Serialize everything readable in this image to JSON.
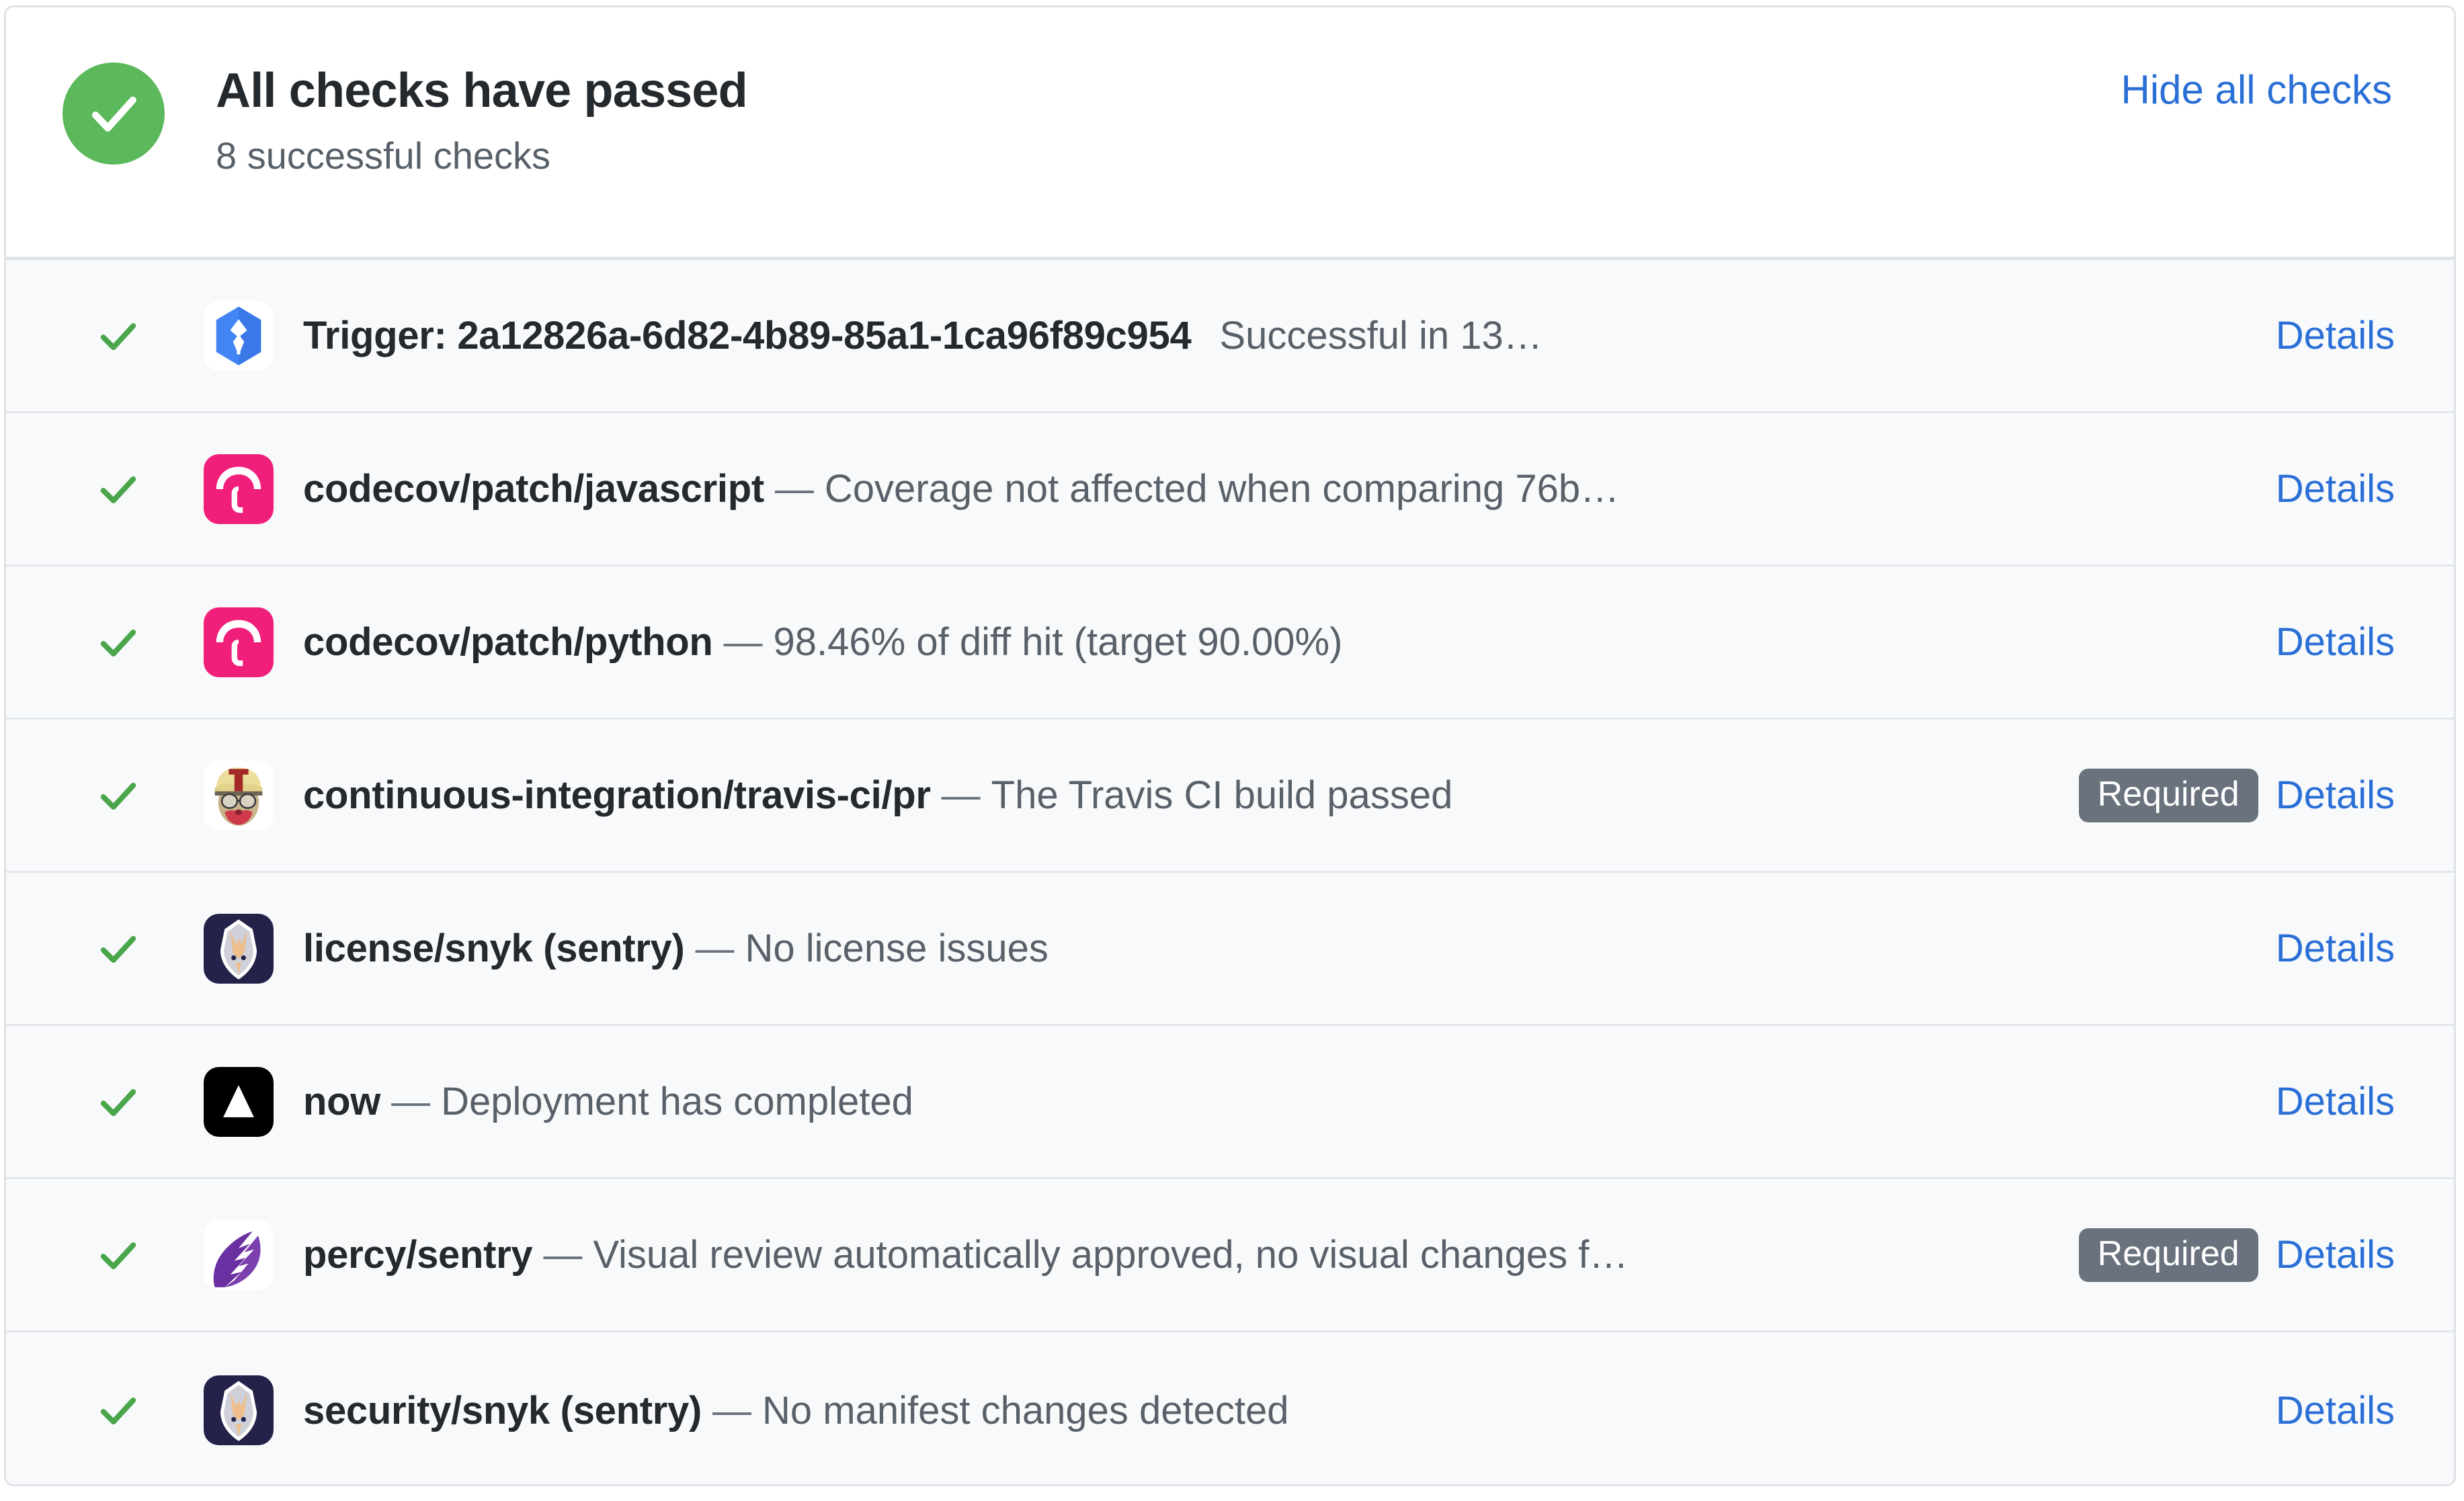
{
  "header": {
    "status_icon": "check-circle-icon",
    "title": "All checks have passed",
    "subtitle": "8 successful checks",
    "action_label": "Hide all checks",
    "accent_color": "#2a6fd6",
    "success_color": "#5bb85b"
  },
  "list": {
    "details_label": "Details",
    "required_label": "Required",
    "dash": "—",
    "rows": [
      {
        "status": "success",
        "avatar": "google-cloud-build-icon",
        "context": "Trigger: 2a12826a-6d82-4b89-85a1-1ca96f89c954",
        "has_dash": false,
        "description": "Successful in 13…",
        "required": false,
        "details": "Details"
      },
      {
        "status": "success",
        "avatar": "codecov-icon",
        "context": "codecov/patch/javascript",
        "has_dash": true,
        "description": "Coverage not affected when comparing 76b…",
        "required": false,
        "details": "Details"
      },
      {
        "status": "success",
        "avatar": "codecov-icon",
        "context": "codecov/patch/python",
        "has_dash": true,
        "description": "98.46% of diff hit (target 90.00%)",
        "required": false,
        "details": "Details"
      },
      {
        "status": "success",
        "avatar": "travis-ci-icon",
        "context": "continuous-integration/travis-ci/pr",
        "has_dash": true,
        "description": "The Travis CI build passed",
        "required": true,
        "details": "Details"
      },
      {
        "status": "success",
        "avatar": "snyk-icon",
        "context": "license/snyk (sentry)",
        "has_dash": true,
        "description": "No license issues",
        "required": false,
        "details": "Details"
      },
      {
        "status": "success",
        "avatar": "now-vercel-icon",
        "context": "now",
        "has_dash": true,
        "description": "Deployment has completed",
        "required": false,
        "details": "Details"
      },
      {
        "status": "success",
        "avatar": "percy-icon",
        "context": "percy/sentry",
        "has_dash": true,
        "description": "Visual review automatically approved, no visual changes f…",
        "required": true,
        "details": "Details"
      },
      {
        "status": "success",
        "avatar": "snyk-icon",
        "context": "security/snyk (sentry)",
        "has_dash": true,
        "description": "No manifest changes detected",
        "required": false,
        "details": "Details"
      }
    ]
  }
}
